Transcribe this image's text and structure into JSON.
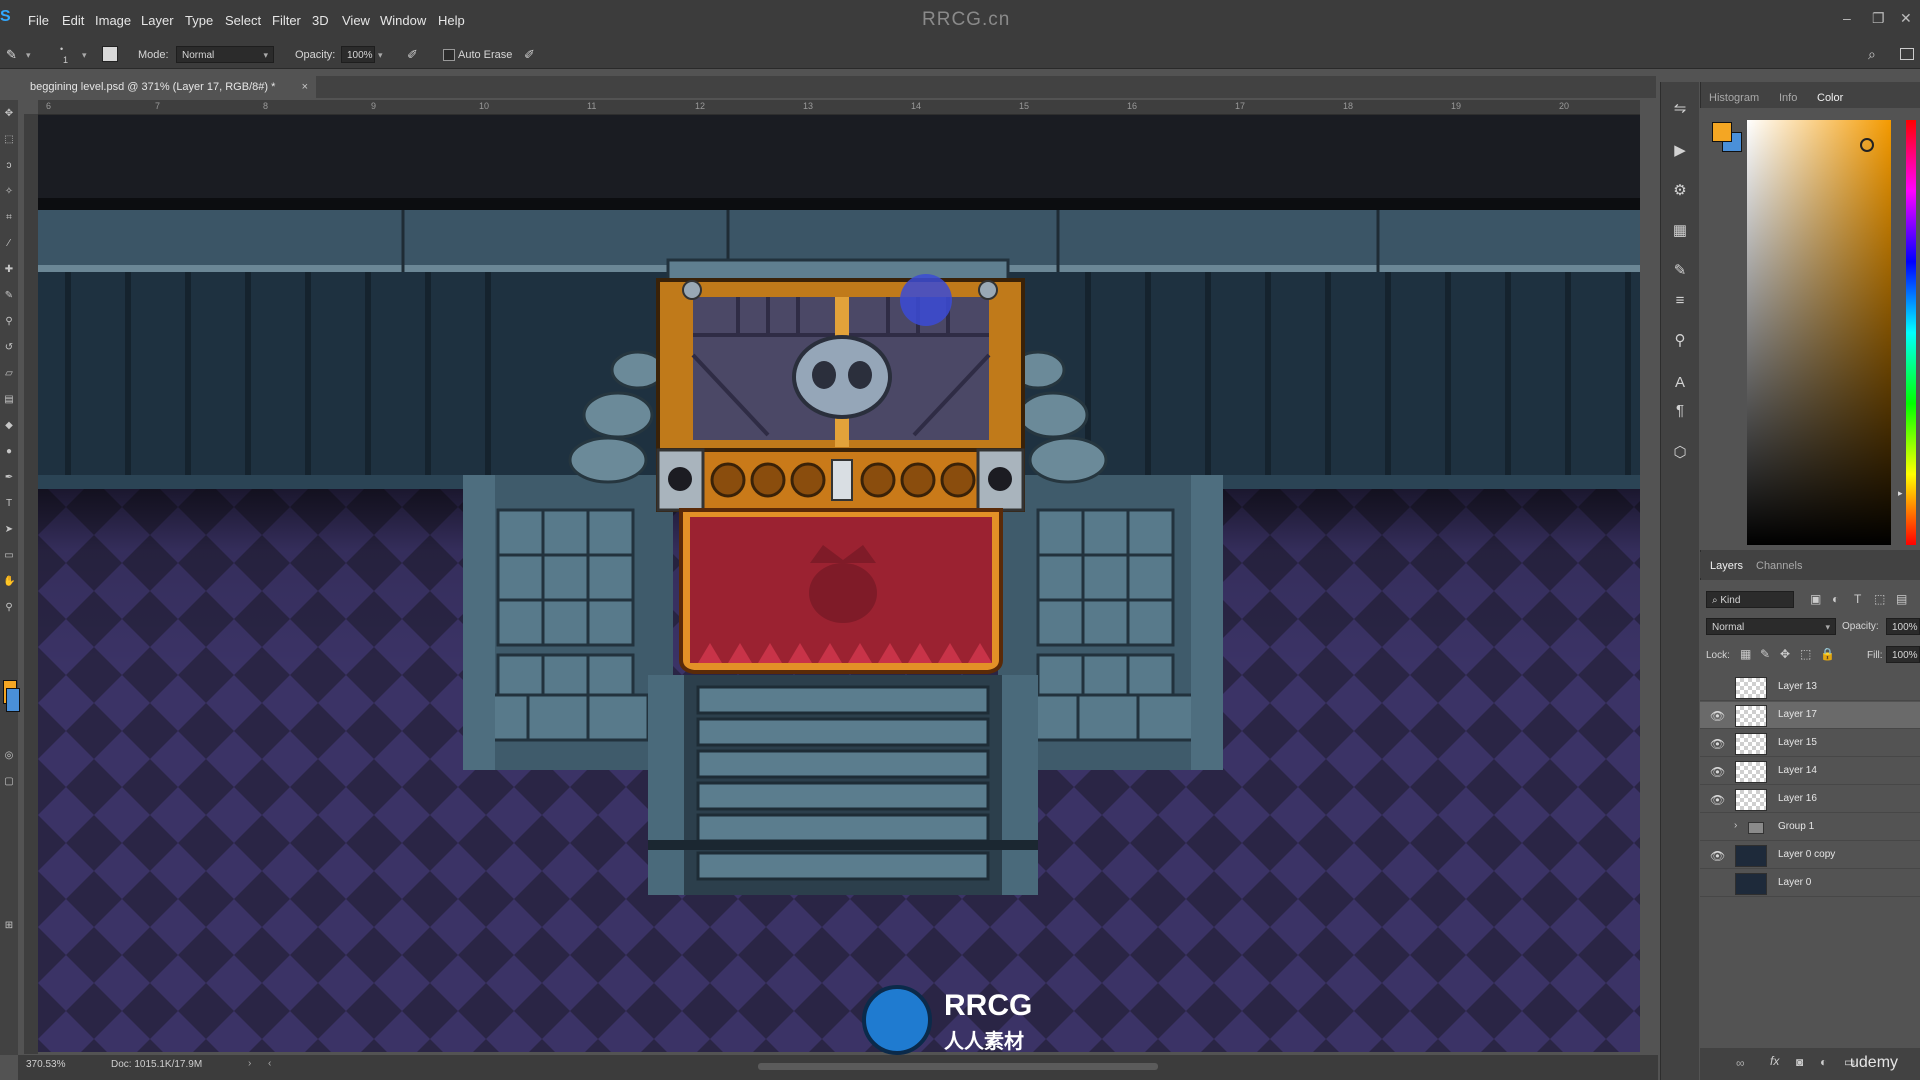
{
  "app": {
    "title_watermark": "RRCG.cn",
    "menu": [
      "File",
      "Edit",
      "Image",
      "Layer",
      "Type",
      "Select",
      "Filter",
      "3D",
      "View",
      "Window",
      "Help"
    ],
    "window_controls": [
      "–",
      "❐",
      "✕"
    ]
  },
  "options_bar": {
    "brush_size": "1",
    "mode_label": "Mode:",
    "mode_value": "Normal",
    "opacity_label": "Opacity:",
    "opacity_value": "100%",
    "auto_erase_label": "Auto Erase"
  },
  "document": {
    "tab_title": "beggining level.psd @ 371% (Layer 17, RGB/8#) *",
    "ruler_ticks": [
      "6",
      "7",
      "8",
      "9",
      "10",
      "11",
      "12",
      "13",
      "14",
      "15",
      "16",
      "17",
      "18",
      "19",
      "20"
    ]
  },
  "status": {
    "zoom": "370.53%",
    "doc_size": "Doc: 1015.1K/17.9M"
  },
  "panels": {
    "top_tabs": [
      "Histogram",
      "Info",
      "Color"
    ],
    "active_top_tab": "Color",
    "layer_tabs": [
      "Layers",
      "Channels"
    ],
    "kind_label": "Kind",
    "blend_mode": "Normal",
    "opacity_label": "Opacity:",
    "opacity_value": "100%",
    "lock_label": "Lock:",
    "fill_label": "Fill:",
    "fill_value": "100%",
    "layers": [
      {
        "name": "Layer 13",
        "visible": false,
        "selected": false,
        "thumb": "checker"
      },
      {
        "name": "Layer 17",
        "visible": true,
        "selected": true,
        "thumb": "checker"
      },
      {
        "name": "Layer 15",
        "visible": true,
        "selected": false,
        "thumb": "checker"
      },
      {
        "name": "Layer 14",
        "visible": true,
        "selected": false,
        "thumb": "checker"
      },
      {
        "name": "Layer 16",
        "visible": true,
        "selected": false,
        "thumb": "checker"
      },
      {
        "name": "Group 1",
        "visible": false,
        "selected": false,
        "thumb": "folder"
      },
      {
        "name": "Layer 0 copy",
        "visible": true,
        "selected": false,
        "thumb": "dark"
      },
      {
        "name": "Layer 0",
        "visible": false,
        "selected": false,
        "thumb": "dark"
      }
    ],
    "bottom_watermark": "udemy"
  },
  "overlay": {
    "logo_text": "RRCG",
    "logo_subtext": "人人素材"
  },
  "colors": {
    "foreground": "#f4a623",
    "background": "#4a90d9",
    "accent_blue": "#31a8ff"
  }
}
